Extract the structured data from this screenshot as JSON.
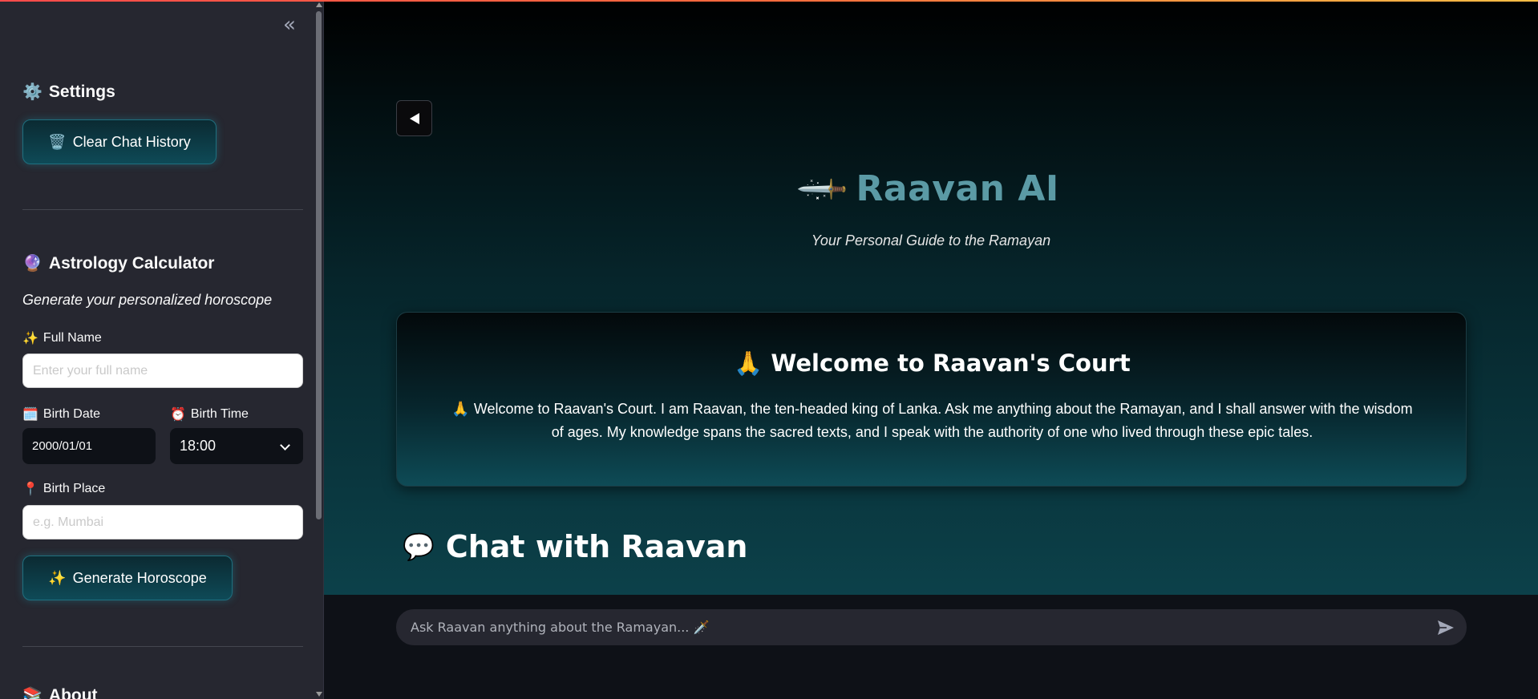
{
  "sidebar": {
    "collapse_icon": "«",
    "settings": {
      "icon": "⚙️",
      "title": "Settings",
      "clear_button": {
        "icon": "🗑️",
        "label": "Clear Chat History"
      }
    },
    "astrology": {
      "icon": "🔮",
      "title": "Astrology Calculator",
      "subtitle": "Generate your personalized horoscope",
      "full_name": {
        "icon": "✨",
        "label": "Full Name",
        "value": "",
        "placeholder": "Enter your full name"
      },
      "birth_date": {
        "icon": "🗓️",
        "label": "Birth Date",
        "value": "2000/01/01"
      },
      "birth_time": {
        "icon": "⏰",
        "label": "Birth Time",
        "value": "18:00"
      },
      "birth_place": {
        "icon": "📍",
        "label": "Birth Place",
        "value": "",
        "placeholder": "e.g. Mumbai"
      },
      "generate_button": {
        "icon": "✨",
        "label": "Generate Horoscope"
      }
    },
    "about": {
      "icon": "📚",
      "title": "About"
    }
  },
  "main": {
    "title_icon": "🗡️",
    "title": "Raavan AI",
    "subtitle": "Your Personal Guide to the Ramayan",
    "welcome": {
      "icon": "🙏",
      "title": "Welcome to Raavan's Court",
      "text": "🙏 Welcome to Raavan's Court. I am Raavan, the ten-headed king of Lanka. Ask me anything about the Ramayan, and I shall answer with the wisdom of ages. My knowledge spans the sacred texts, and I speak with the authority of one who lived through these epic tales."
    },
    "chat": {
      "icon": "💬",
      "heading": "Chat with Raavan",
      "input_placeholder": "Ask Raavan anything about the Ramayan... 🗡️"
    }
  },
  "colors": {
    "sidebar_bg": "#262730",
    "accent_teal": "#0e4a57",
    "title_color": "#5b9aa5",
    "top_line": "#ff4b4b"
  }
}
